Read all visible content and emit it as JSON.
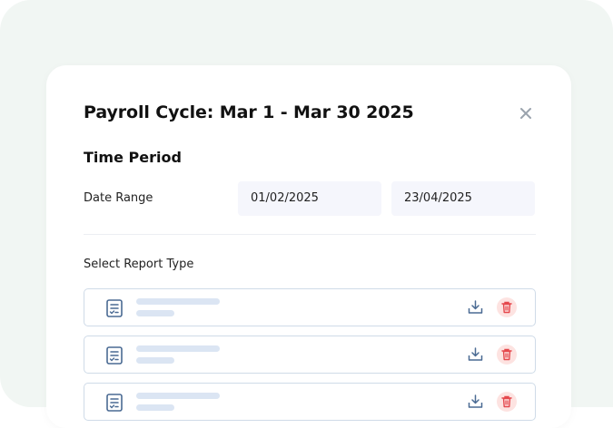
{
  "dialog": {
    "title": "Payroll Cycle: Mar 1 - Mar 30 2025",
    "close_icon": "close-icon"
  },
  "time_period": {
    "heading": "Time Period",
    "date_range_label": "Date Range",
    "start_date": "01/02/2025",
    "end_date": "23/04/2025"
  },
  "report_type": {
    "label": "Select Report Type",
    "items": [
      {
        "icon": "report-document-icon",
        "actions": [
          "download-icon",
          "delete-icon"
        ]
      },
      {
        "icon": "report-document-icon",
        "actions": [
          "download-icon",
          "delete-icon"
        ]
      },
      {
        "icon": "report-document-icon",
        "actions": [
          "download-icon",
          "delete-icon"
        ]
      }
    ]
  },
  "colors": {
    "backdrop": "#f1f6f3",
    "field_background": "#f5f6fc",
    "icon_blue": "#4a6a93",
    "delete_red": "#e5484d",
    "delete_bg": "#fde3e1"
  }
}
